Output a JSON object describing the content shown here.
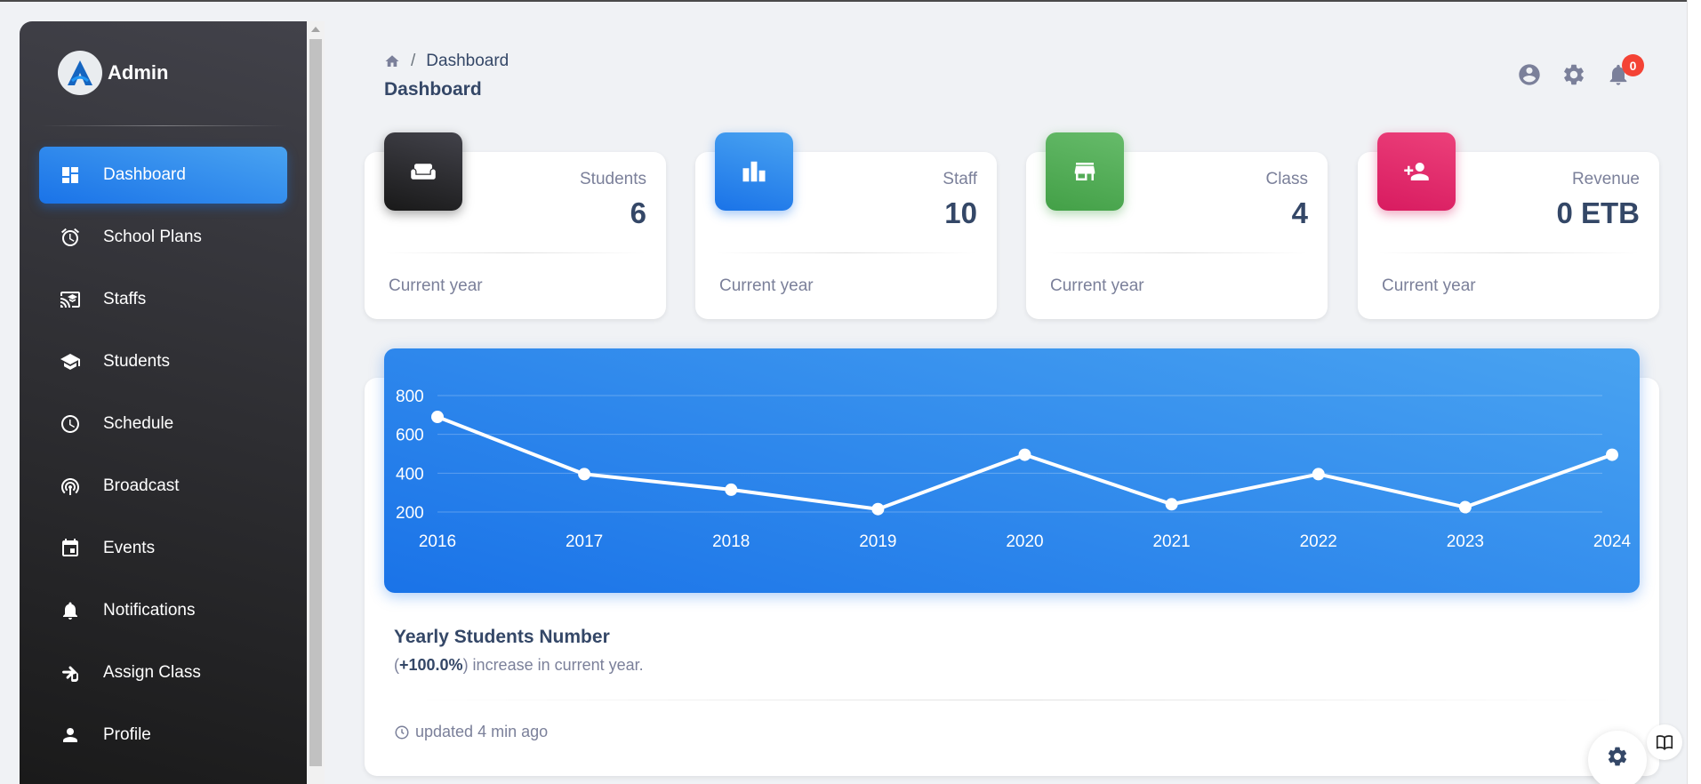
{
  "sidebar": {
    "brand": "Admin",
    "items": [
      {
        "label": "Dashboard",
        "icon": "dashboard-icon",
        "active": true
      },
      {
        "label": "School Plans",
        "icon": "alarm-clock-icon"
      },
      {
        "label": "Staffs",
        "icon": "cast-for-education-icon"
      },
      {
        "label": "Students",
        "icon": "graduation-cap-icon"
      },
      {
        "label": "Schedule",
        "icon": "clock-icon"
      },
      {
        "label": "Broadcast",
        "icon": "podcast-icon"
      },
      {
        "label": "Events",
        "icon": "calendar-event-icon"
      },
      {
        "label": "Notifications",
        "icon": "bell-icon"
      },
      {
        "label": "Assign Class",
        "icon": "hand-icon"
      },
      {
        "label": "Profile",
        "icon": "person-icon"
      }
    ]
  },
  "header": {
    "breadcrumb": "Dashboard",
    "separator": "/",
    "title": "Dashboard",
    "notifications_count": "0"
  },
  "cards": [
    {
      "label": "Students",
      "value": "6",
      "footer": "Current year",
      "icon": "weekend-icon",
      "color": "#1a1a1a"
    },
    {
      "label": "Staff",
      "value": "10",
      "footer": "Current year",
      "icon": "leaderboard-icon",
      "color": "#1a73e8"
    },
    {
      "label": "Class",
      "value": "4",
      "footer": "Current year",
      "icon": "store-icon",
      "color": "#4caf50"
    },
    {
      "label": "Revenue",
      "value": "0 ETB",
      "footer": "Current year",
      "icon": "person-add-icon",
      "color": "#e91e63"
    }
  ],
  "chart": {
    "title": "Yearly Students Number",
    "subtitle_prefix": "(",
    "subtitle_highlight": "+100.0%",
    "subtitle_suffix": ") increase in current year.",
    "updated": "updated 4 min ago"
  },
  "chart_data": {
    "type": "line",
    "x": [
      "2016",
      "2017",
      "2018",
      "2019",
      "2020",
      "2021",
      "2022",
      "2023",
      "2024"
    ],
    "series": [
      {
        "values": [
          690,
          395,
          315,
          215,
          495,
          240,
          395,
          225,
          495
        ]
      }
    ],
    "yticks": [
      "200",
      "400",
      "600",
      "800"
    ],
    "ylim": [
      200,
      800
    ],
    "grid": true,
    "color": "#ffffff"
  }
}
